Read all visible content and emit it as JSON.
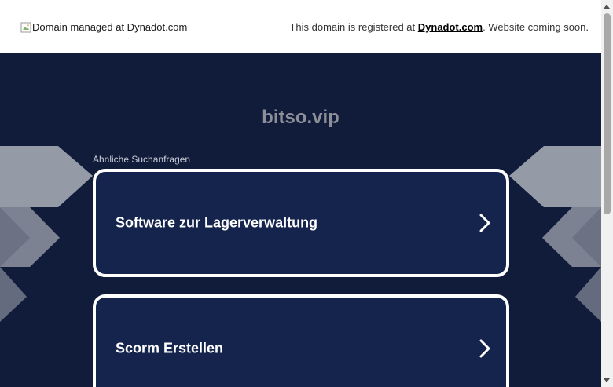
{
  "header": {
    "logo_alt": "Domain managed at Dynadot.com",
    "note_prefix": "This domain is registered at ",
    "note_link": "Dynadot.com",
    "note_suffix": ". Website coming soon."
  },
  "main": {
    "domain": "bitso.vip",
    "related_label": "Ähnliche Suchanfragen",
    "searches": [
      {
        "label": "Software zur Lagerverwaltung"
      },
      {
        "label": "Scorm Erstellen"
      }
    ]
  },
  "colors": {
    "background": "#101c3a",
    "card": "#14244c",
    "card_border": "#ffffff",
    "domain_text": "#8c8f99"
  },
  "icons": {
    "logo": "broken-image-icon",
    "card_arrow": "chevron-right-icon"
  }
}
